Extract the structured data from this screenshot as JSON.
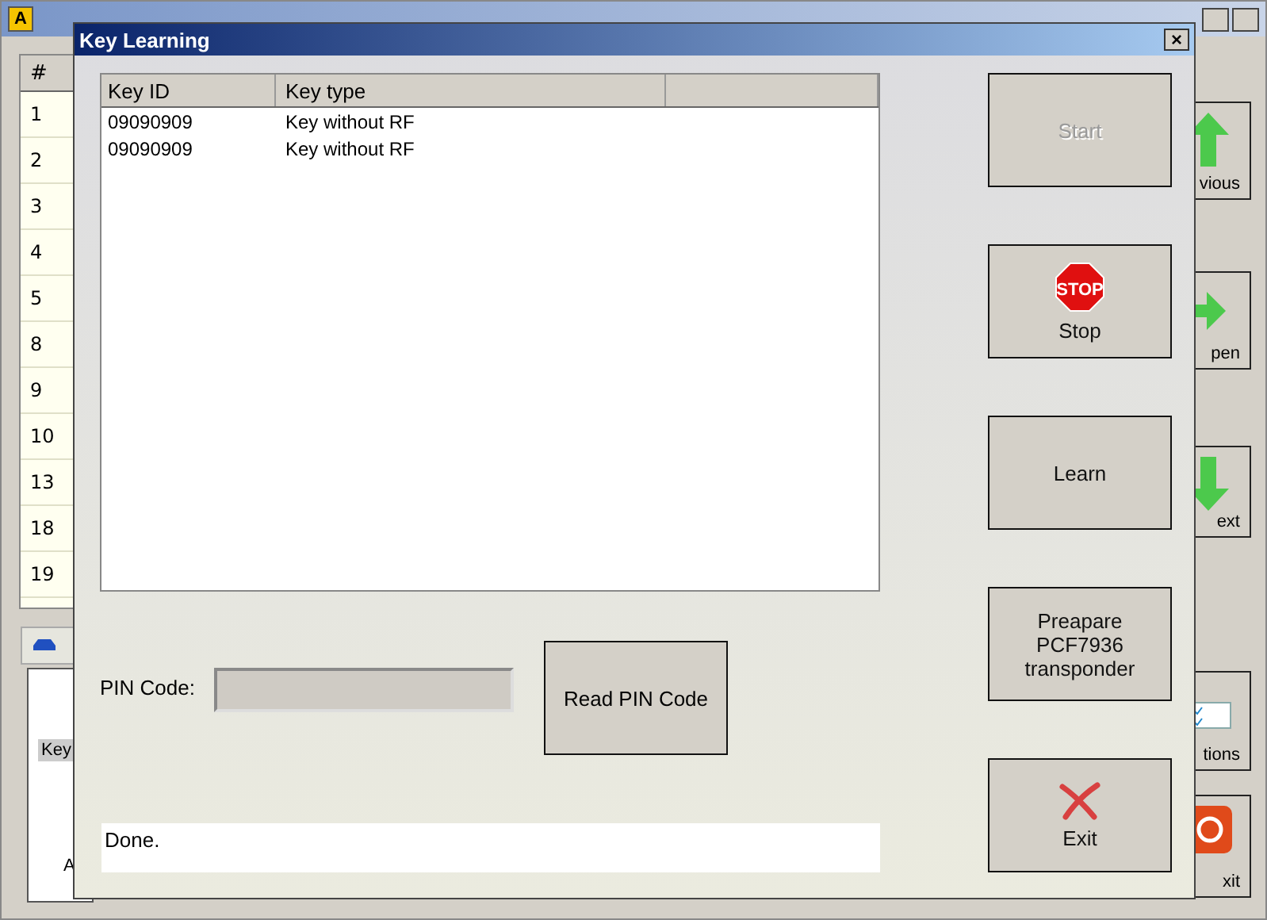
{
  "main_window": {
    "app_icon": "A",
    "table": {
      "columns": [
        "#"
      ],
      "rows": [
        "1",
        "2",
        "3",
        "4",
        "5",
        "8",
        "9",
        "10",
        "13",
        "18",
        "19"
      ]
    },
    "tab": {
      "kind": "car"
    },
    "panel": {
      "label": "Key",
      "text": "A"
    },
    "side_buttons": [
      {
        "label": "vious",
        "kind": "up"
      },
      {
        "label": "pen",
        "kind": "open"
      },
      {
        "label": "ext",
        "kind": "down"
      },
      {
        "label": "tions",
        "kind": "options"
      },
      {
        "label": "xit",
        "kind": "power"
      }
    ]
  },
  "dialog": {
    "title": "Key Learning",
    "close": "×",
    "list": {
      "columns": [
        "Key ID",
        "Key type"
      ],
      "rows": [
        {
          "key_id": "09090909",
          "key_type": "Key without RF"
        },
        {
          "key_id": "09090909",
          "key_type": "Key without RF"
        }
      ]
    },
    "pin_label": "PIN Code:",
    "pin_field": {
      "disabled": true
    },
    "read_pin_button": "Read PIN Code",
    "status": "Done.",
    "buttons": [
      {
        "label": "Start",
        "kind": "plain",
        "disabled": true
      },
      {
        "label": "Stop",
        "kind": "stop",
        "disabled": false,
        "icon_text": "STOP"
      },
      {
        "label": "Learn",
        "kind": "plain",
        "disabled": false
      },
      {
        "label": "Preapare PCF7936 transponder",
        "kind": "plain",
        "disabled": false
      },
      {
        "label": "Exit",
        "kind": "exit",
        "disabled": false
      }
    ]
  }
}
